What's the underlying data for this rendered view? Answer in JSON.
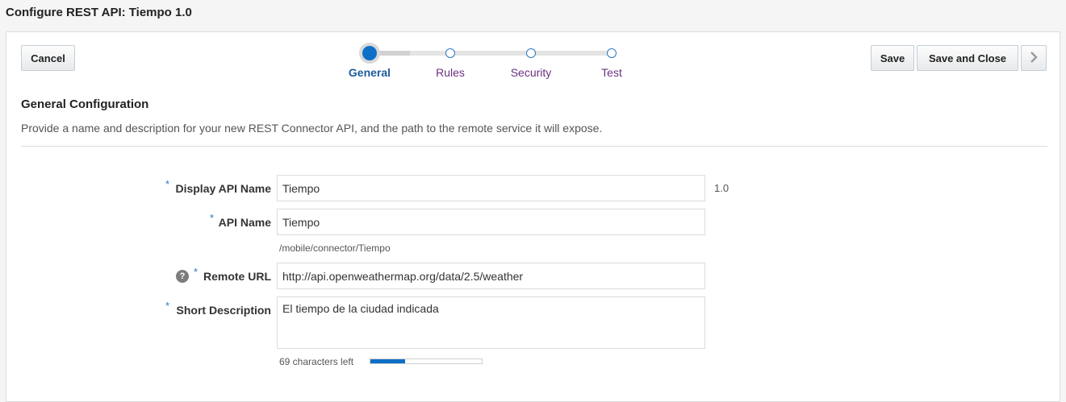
{
  "window": {
    "title": "Configure REST API: Tiempo 1.0"
  },
  "toolbar": {
    "cancel_label": "Cancel",
    "save_label": "Save",
    "save_close_label": "Save and Close",
    "next_icon": "chevron-right-icon"
  },
  "train": {
    "steps": [
      {
        "label": "General",
        "state": "current"
      },
      {
        "label": "Rules",
        "state": "pending"
      },
      {
        "label": "Security",
        "state": "pending"
      },
      {
        "label": "Test",
        "state": "pending"
      }
    ]
  },
  "section": {
    "title": "General Configuration",
    "description": "Provide a name and description for your new REST Connector API, and the path to the remote service it will expose."
  },
  "form": {
    "required_marker": "*",
    "display_name": {
      "label": "Display API Name",
      "value": "Tiempo",
      "version": "1.0"
    },
    "api_name": {
      "label": "API Name",
      "value": "Tiempo",
      "path_hint": "/mobile/connector/Tiempo"
    },
    "remote_url": {
      "label": "Remote URL",
      "value": "http://api.openweathermap.org/data/2.5/weather",
      "help_icon": "?"
    },
    "short_description": {
      "label": "Short Description",
      "value": "El tiempo de la ciudad indicada",
      "chars_left": "69 characters left",
      "fill_fraction": 0.31
    }
  },
  "colors": {
    "accent": "#0f6fc6",
    "link": "#6b3082",
    "required": "#2b79c2"
  }
}
